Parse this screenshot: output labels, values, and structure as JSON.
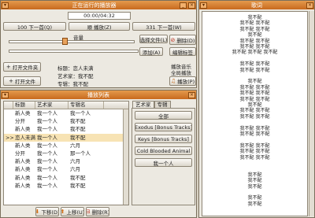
{
  "player": {
    "title": "正在运行的播放器",
    "time": "00:00/04:32",
    "prev_btn": "100 下一首(Q)",
    "mode_btn": "顺 播放(Z)",
    "next_btn": "331 下一首(W)",
    "volume_label": "音量",
    "select_file_btn": "选择文件(L)",
    "delete_btn": "删除(D)",
    "add_btn": "添加(A)",
    "tag_btn": "编辑标签",
    "open_folder_btn": "打开文件夹",
    "open_file_btn": "打开文件",
    "info_title": "标题：恋人未满",
    "info_artist": "艺术家：我不配",
    "info_album": "专辑：我不配",
    "note1": "播放音乐",
    "note2": "全局播放",
    "play_btn": "播放(P)"
  },
  "playlist": {
    "title": "播放列表",
    "headers": [
      "",
      "标题",
      "艺术家",
      "专辑名"
    ],
    "rows": [
      [
        "",
        "新人类",
        "我一个人",
        "我一个人"
      ],
      [
        "",
        "分开",
        "我一个人",
        "我不配"
      ],
      [
        "",
        "新人类",
        "我一个人",
        "我不配"
      ],
      [
        ">>>",
        "恋人未满",
        "我一个人",
        "我不配"
      ],
      [
        "",
        "新人类",
        "我一个人",
        "六月"
      ],
      [
        "",
        "分开",
        "我一个人",
        "那一个人"
      ],
      [
        "",
        "新人类",
        "我一个人",
        "六月"
      ],
      [
        "",
        "新人类",
        "我一个人",
        "六月"
      ],
      [
        "",
        "新人类",
        "我一个人",
        "我不配"
      ],
      [
        "",
        "新人类",
        "我一个人",
        "我不配"
      ]
    ],
    "tab_artist": "艺术家",
    "tab_album": "专辑",
    "filters": [
      "全部",
      "Exodus [Bonus Tracks]",
      "Keys [Bonus Tracks]",
      "Cold Blooded Animal",
      "我一个人"
    ],
    "down_btn": "下移(D)",
    "up_btn": "上移(U)",
    "remove_btn": "删除(R)"
  },
  "lyrics": {
    "title": "歌词",
    "lines": [
      "我不配",
      "我不配 我不配",
      "我不配 我不配",
      "我不配",
      "我不配 我不配",
      "我不配 我不配",
      "我不配 我不配 我不配",
      "",
      "我不配 我不配",
      "我不配 我不配",
      "",
      "我不配",
      "我不配 我不配",
      "我不配 我不配",
      "我不配 我不配",
      "我不配",
      "我不配 我不配",
      "我不配 我不配",
      "",
      "我不配 我不配",
      "我不配 我不配",
      "",
      "我不配 我不配",
      "我不配 我不配",
      "我不配 我不配",
      "",
      "",
      "我不配",
      "我不配",
      "我不配",
      "",
      "我不配",
      "我不配"
    ]
  }
}
